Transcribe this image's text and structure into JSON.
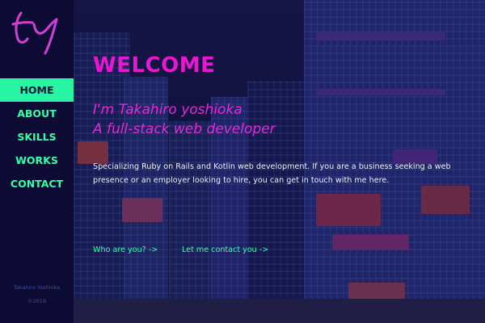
{
  "logo": {
    "text": "ty",
    "color": "#d23fd6"
  },
  "nav": {
    "items": [
      {
        "label": "HOME",
        "active": true
      },
      {
        "label": "ABOUT",
        "active": false
      },
      {
        "label": "SKILLS",
        "active": false
      },
      {
        "label": "WORKS",
        "active": false
      },
      {
        "label": "CONTACT",
        "active": false
      }
    ]
  },
  "footer": {
    "name": "Takahiro Yoshioka",
    "copyright": "©2019"
  },
  "main": {
    "title": "WELCOME",
    "intro_line1": "I'm Takahiro yoshioka",
    "intro_line2": "A full-stack web developer",
    "description": "Specializing Ruby on Rails and Kotlin web development. If you are a business seeking a web presence or an employer looking to hire, you can get in touch with me here.",
    "links": {
      "who": "Who are you? ->",
      "contact": "Let me contact you ->"
    }
  },
  "colors": {
    "accent_green": "#27f5a4",
    "accent_magenta": "#e817d2",
    "sidebar_bg": "#0d0b33"
  }
}
